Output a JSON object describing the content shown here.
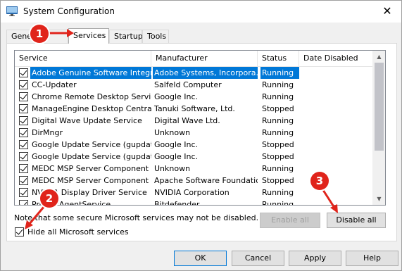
{
  "window": {
    "title": "System Configuration",
    "close_glyph": "✕"
  },
  "tabs": [
    "General",
    "Services",
    "Startup",
    "Tools"
  ],
  "tab_general_visible": "Gene",
  "columns": [
    "Service",
    "Manufacturer",
    "Status",
    "Date Disabled"
  ],
  "services": [
    {
      "name": "Adobe Genuine Software Integri...",
      "manufacturer": "Adobe Systems, Incorpora...",
      "status": "Running",
      "checked": true,
      "selected": true
    },
    {
      "name": "CC-Updater",
      "manufacturer": "Salfeld Computer",
      "status": "Running",
      "checked": true
    },
    {
      "name": "Chrome Remote Desktop Service",
      "manufacturer": "Google Inc.",
      "status": "Running",
      "checked": true
    },
    {
      "name": "ManageEngine Desktop Central ...",
      "manufacturer": "Tanuki Software, Ltd.",
      "status": "Stopped",
      "checked": true
    },
    {
      "name": "Digital Wave Update Service",
      "manufacturer": "Digital Wave Ltd.",
      "status": "Running",
      "checked": true
    },
    {
      "name": "DirMngr",
      "manufacturer": "Unknown",
      "status": "Running",
      "checked": true
    },
    {
      "name": "Google Update Service (gupdate)",
      "manufacturer": "Google Inc.",
      "status": "Stopped",
      "checked": true
    },
    {
      "name": "Google Update Service (gupdatem)",
      "manufacturer": "Google Inc.",
      "status": "Stopped",
      "checked": true
    },
    {
      "name": "MEDC MSP Server Component - ...",
      "manufacturer": "Unknown",
      "status": "Running",
      "checked": true
    },
    {
      "name": "MEDC MSP Server Component - ...",
      "manufacturer": "Apache Software Foundation",
      "status": "Stopped",
      "checked": true
    },
    {
      "name": "NVIDIA Display Driver Service",
      "manufacturer": "NVIDIA Corporation",
      "status": "Running",
      "checked": true
    },
    {
      "name": "ProtectAgentService",
      "manufacturer": "Bitdefender",
      "status": "Running",
      "checked": true
    }
  ],
  "note": "Note that some secure Microsoft services may not be disabled.",
  "hide_ms": {
    "label": "Hide all Microsoft services",
    "checked": true
  },
  "buttons": {
    "enable_all": "Enable all",
    "disable_all": "Disable all",
    "ok": "OK",
    "cancel": "Cancel",
    "apply": "Apply",
    "help": "Help"
  },
  "markers": [
    "1",
    "2",
    "3"
  ],
  "colors": {
    "selection": "#0078d7",
    "marker": "#e0241b"
  }
}
